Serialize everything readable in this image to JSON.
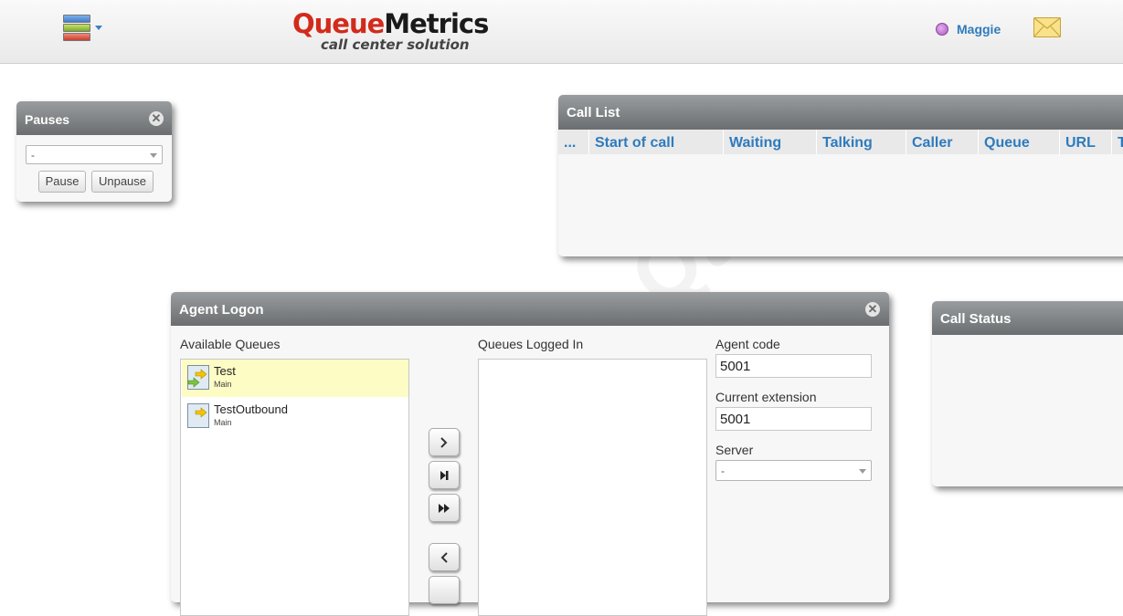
{
  "header": {
    "logo_main_red": "Queue",
    "logo_main_dark": "Metrics",
    "logo_sub": "call center solution",
    "user_name": "Maggie",
    "icons": {
      "menu": "menu-stack-icon",
      "user": "user-status-dot-icon",
      "mail": "mail-envelope-icon"
    }
  },
  "pauses": {
    "title": "Pauses",
    "select_value": "-",
    "pause_label": "Pause",
    "unpause_label": "Unpause"
  },
  "call_list": {
    "title": "Call List",
    "columns": [
      "...",
      "Start of call",
      "Waiting",
      "Talking",
      "Caller",
      "Queue",
      "URL",
      "T"
    ]
  },
  "agent_logon": {
    "title": "Agent Logon",
    "available_label": "Available Queues",
    "logged_in_label": "Queues Logged In",
    "queues": [
      {
        "name": "Test",
        "sub": "Main",
        "selected": true
      },
      {
        "name": "TestOutbound",
        "sub": "Main",
        "selected": false
      }
    ],
    "agent_code_label": "Agent code",
    "agent_code_value": "5001",
    "extension_label": "Current extension",
    "extension_value": "5001",
    "server_label": "Server",
    "server_value": "-"
  },
  "call_status": {
    "title": "Call Status"
  },
  "colors": {
    "accent_blue": "#2e7bbd",
    "logo_red": "#d22b1c",
    "panel_title_gray": "#7c7f81",
    "selected_row": "#fcfcc4"
  }
}
